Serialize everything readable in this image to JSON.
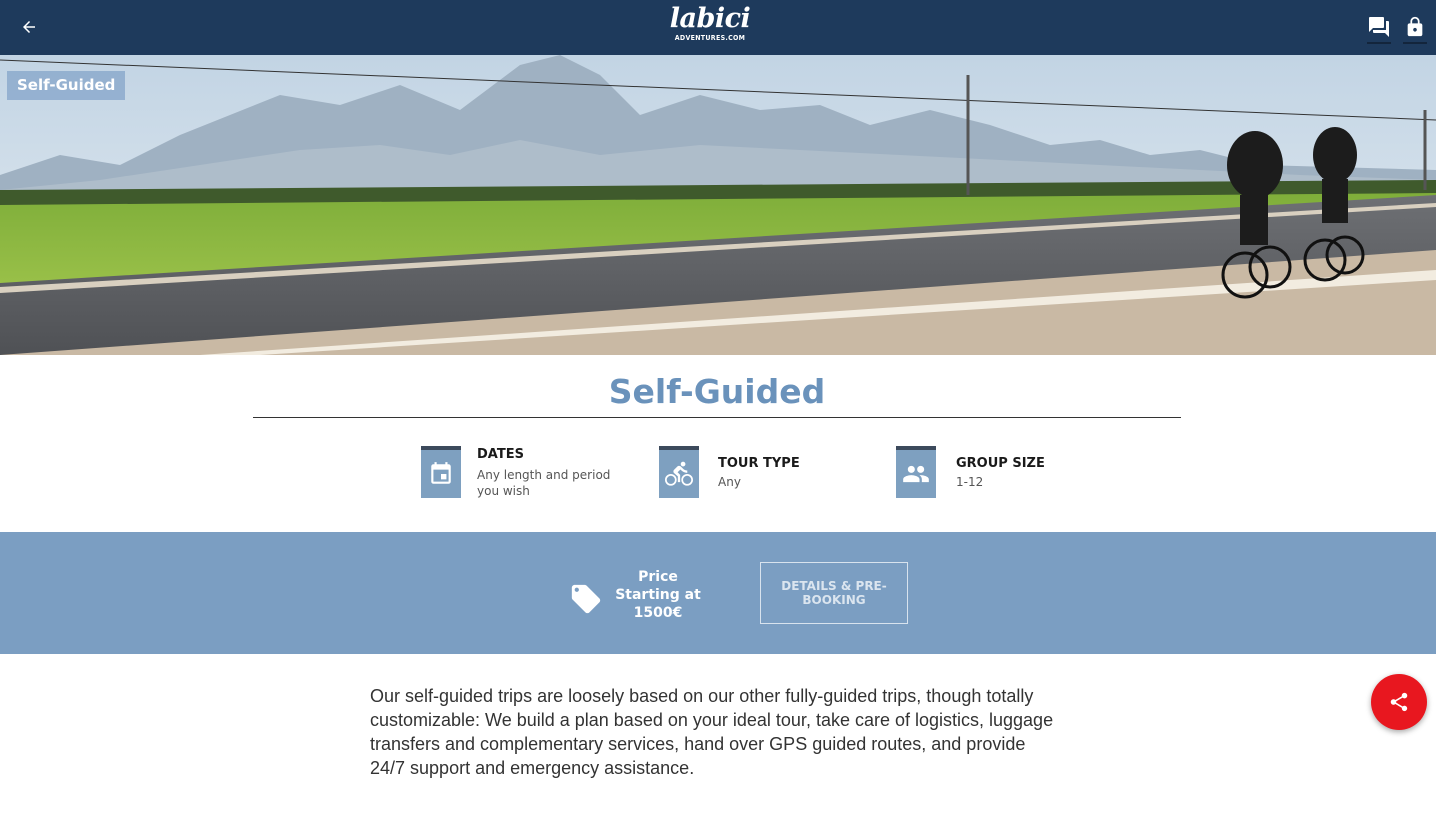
{
  "header": {
    "back_icon": "arrow-left-icon",
    "logo_main": "labici",
    "logo_sub": "ADVENTURES.COM",
    "chat_icon": "chat-bubbles-icon",
    "lock_icon": "lock-icon"
  },
  "hero": {
    "badge": "Self-Guided"
  },
  "page": {
    "title": "Self-Guided"
  },
  "features": [
    {
      "icon": "calendar-icon",
      "title": "DATES",
      "value": "Any length and period you wish"
    },
    {
      "icon": "bicycle-icon",
      "title": "TOUR TYPE",
      "value": "Any"
    },
    {
      "icon": "group-icon",
      "title": "GROUP SIZE",
      "value": "1-12"
    }
  ],
  "price": {
    "icon": "price-tag-icon",
    "label": "Price",
    "prefix": "Starting at",
    "amount": "1500€",
    "button": "DETAILS & PRE-BOOKING"
  },
  "description": "Our self-guided trips are loosely based on our other fully-guided trips, though totally customizable: We build a plan based on your ideal tour, take care of logistics, luggage transfers and complementary services, hand over GPS guided routes, and provide 24/7 support and emergency assistance.",
  "share": {
    "icon": "share-icon"
  },
  "colors": {
    "topbar": "#1e3a5c",
    "accent": "#6a92bb",
    "band": "#7b9ec2",
    "fab": "#e8171f"
  }
}
